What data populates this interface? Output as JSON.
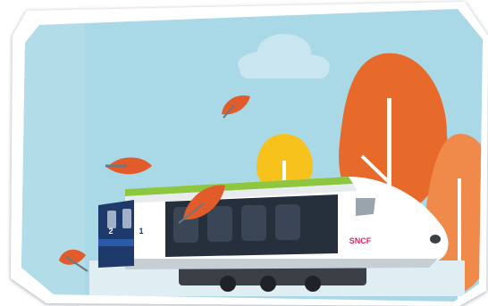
{
  "scene": {
    "train": {
      "car_numbers": [
        "2",
        "1"
      ],
      "logo_text": "SNCF",
      "logo_color": "#e0245e",
      "body_color": "#ffffff",
      "stripe_color": "#8dc63f",
      "window_color": "#26303d",
      "nose_color": "#1e3a6b"
    },
    "palette": {
      "sky": "#a9d8e6",
      "cloud": "#c9e6f0",
      "tree_orange": "#e86a2a",
      "tree_light_orange": "#f08a4a",
      "sun_yellow": "#f7c21c",
      "leaf": "#e15c2a",
      "frame_shadow": "#9aa8b3"
    }
  }
}
